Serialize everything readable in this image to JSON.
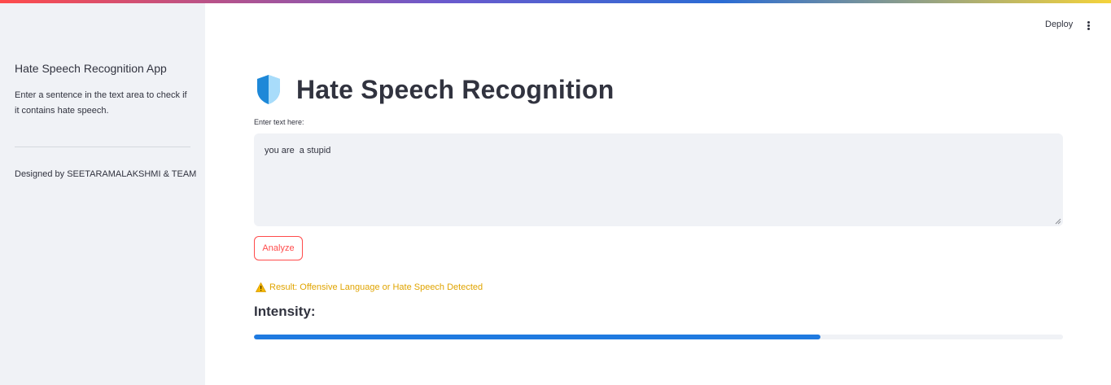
{
  "sidebar": {
    "title": "Hate Speech Recognition App",
    "description": "Enter a sentence in the text area to check if it contains hate speech.",
    "credit": "Designed by SEETARAMALAKSHMI & TEAM"
  },
  "header": {
    "deploy_label": "Deploy",
    "menu_icon": "more-vertical-icon"
  },
  "main": {
    "title_icon": "shield-icon",
    "title": "Hate Speech Recognition",
    "input_label": "Enter text here:",
    "input_value": "you are  a stupid",
    "analyze_label": "Analyze",
    "result_icon": "warning-icon",
    "result_text": "Result: Offensive Language or Hate Speech Detected",
    "intensity_heading": "Intensity:",
    "intensity_value": 0.7
  },
  "colors": {
    "accent": "#ff4b4b",
    "progress": "#1f7ae0",
    "warning": "#e0a400",
    "sidebar_bg": "#f0f2f6"
  }
}
